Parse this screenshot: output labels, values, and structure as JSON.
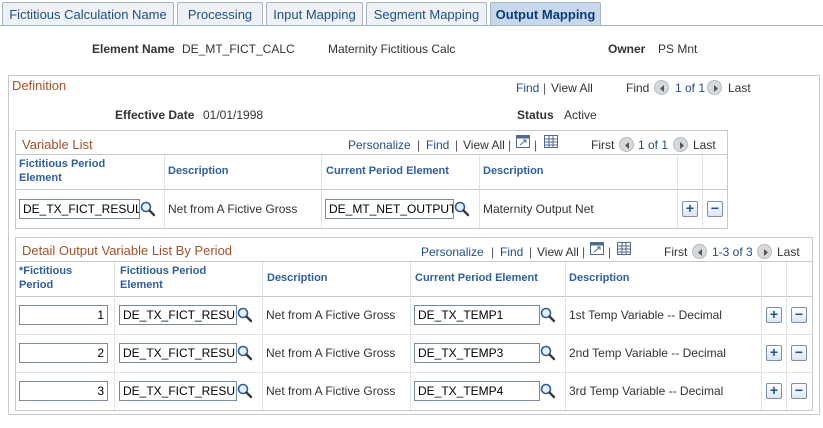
{
  "tabs": [
    {
      "label": "Fictitious Calculation Name",
      "active": false
    },
    {
      "label": "Processing",
      "active": false
    },
    {
      "label": "Input Mapping",
      "active": false
    },
    {
      "label": "Segment Mapping",
      "active": false
    },
    {
      "label": "Output Mapping",
      "active": true
    }
  ],
  "header": {
    "element_name_label": "Element Name",
    "element_name_value": "DE_MT_FICT_CALC",
    "element_description": "Maternity Fictitious Calc",
    "owner_label": "Owner",
    "owner_value": "PS Mnt"
  },
  "definition": {
    "title": "Definition",
    "find": "Find",
    "view_all": "View All",
    "nav_find": "Find",
    "counter": "1 of 1",
    "last": "Last",
    "effective_date_label": "Effective Date",
    "effective_date_value": "01/01/1998",
    "status_label": "Status",
    "status_value": "Active"
  },
  "variable_list": {
    "title": "Variable List",
    "personalize": "Personalize",
    "find": "Find",
    "view_all": "View All",
    "first": "First",
    "counter": "1 of 1",
    "last": "Last",
    "columns": [
      "Fictitious Period Element",
      "Description",
      "Current Period Element",
      "Description"
    ],
    "rows": [
      {
        "fict_element": "DE_TX_FICT_RESUL",
        "fict_desc": "Net from A Fictive Gross",
        "curr_element": "DE_MT_NET_OUTPUT",
        "curr_desc": "Maternity Output Net"
      }
    ]
  },
  "detail_list": {
    "title": "Detail Output Variable List By Period",
    "personalize": "Personalize",
    "find": "Find",
    "view_all": "View All",
    "first": "First",
    "counter": "1-3 of 3",
    "last": "Last",
    "columns": [
      "*Fictitious Period",
      "Fictitious Period Element",
      "Description",
      "Current Period Element",
      "Description"
    ],
    "rows": [
      {
        "period": "1",
        "fict_element": "DE_TX_FICT_RESUI",
        "fict_desc": "Net from A Fictive Gross",
        "curr_element": "DE_TX_TEMP1",
        "curr_desc": "1st Temp Variable -- Decimal"
      },
      {
        "period": "2",
        "fict_element": "DE_TX_FICT_RESUI",
        "fict_desc": "Net from A Fictive Gross",
        "curr_element": "DE_TX_TEMP3",
        "curr_desc": "2nd Temp Variable -- Decimal"
      },
      {
        "period": "3",
        "fict_element": "DE_TX_FICT_RESUI",
        "fict_desc": "Net from A Fictive Gross",
        "curr_element": "DE_TX_TEMP4",
        "curr_desc": "3rd Temp Variable -- Decimal"
      }
    ]
  },
  "buttons": {
    "add": "+",
    "delete": "−"
  },
  "colors": {
    "link": "#204f87",
    "section_title": "#a0522d",
    "column_header": "#2f5f98",
    "active_tab": "#c7d8ec"
  }
}
